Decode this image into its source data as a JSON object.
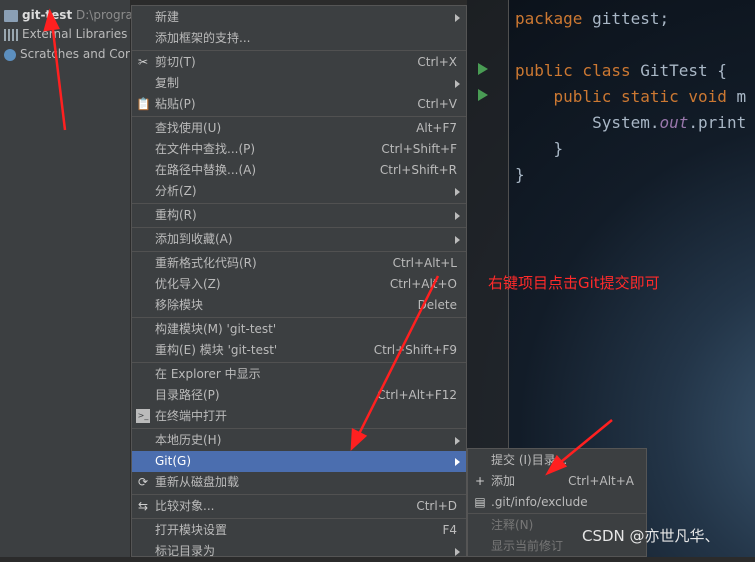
{
  "project_tree": {
    "root_name": "git-test",
    "root_path": "D:\\progra",
    "external_libraries": "External Libraries",
    "scratches": "Scratches and Cor"
  },
  "code_lines": {
    "line1_kw": "package",
    "line1_rest": " gittest;",
    "line2_kw": "public class",
    "line2_rest": " GitTest {",
    "line3_kw": "    public static void",
    "line3_rest": " m",
    "line4_pre": "        System.",
    "line4_field": "out",
    "line4_post": ".print",
    "line5": "    }",
    "line6": "}"
  },
  "context_menu": {
    "items": [
      {
        "label": "新建",
        "shortcut": "",
        "submenu": true,
        "icon": ""
      },
      {
        "label": "添加框架的支持...",
        "shortcut": "",
        "submenu": false,
        "icon": ""
      },
      {
        "label": "剪切(T)",
        "shortcut": "Ctrl+X",
        "submenu": false,
        "icon": "✂"
      },
      {
        "label": "复制",
        "shortcut": "",
        "submenu": true,
        "icon": ""
      },
      {
        "label": "粘贴(P)",
        "shortcut": "Ctrl+V",
        "submenu": false,
        "icon": "📋"
      },
      {
        "label": "查找使用(U)",
        "shortcut": "Alt+F7",
        "submenu": false,
        "icon": ""
      },
      {
        "label": "在文件中查找...(P)",
        "shortcut": "Ctrl+Shift+F",
        "submenu": false,
        "icon": ""
      },
      {
        "label": "在路径中替换...(A)",
        "shortcut": "Ctrl+Shift+R",
        "submenu": false,
        "icon": ""
      },
      {
        "label": "分析(Z)",
        "shortcut": "",
        "submenu": true,
        "icon": ""
      },
      {
        "label": "重构(R)",
        "shortcut": "",
        "submenu": true,
        "icon": ""
      },
      {
        "label": "添加到收藏(A)",
        "shortcut": "",
        "submenu": true,
        "icon": ""
      },
      {
        "label": "重新格式化代码(R)",
        "shortcut": "Ctrl+Alt+L",
        "submenu": false,
        "icon": ""
      },
      {
        "label": "优化导入(Z)",
        "shortcut": "Ctrl+Alt+O",
        "submenu": false,
        "icon": ""
      },
      {
        "label": "移除模块",
        "shortcut": "Delete",
        "submenu": false,
        "icon": ""
      },
      {
        "label": "构建模块(M) 'git-test'",
        "shortcut": "",
        "submenu": false,
        "icon": ""
      },
      {
        "label": "重构(E) 模块 'git-test'",
        "shortcut": "Ctrl+Shift+F9",
        "submenu": false,
        "icon": ""
      },
      {
        "label": "在 Explorer 中显示",
        "shortcut": "",
        "submenu": false,
        "icon": ""
      },
      {
        "label": "目录路径(P)",
        "shortcut": "Ctrl+Alt+F12",
        "submenu": false,
        "icon": ""
      },
      {
        "label": "在终端中打开",
        "shortcut": "",
        "submenu": false,
        "icon": ">_"
      },
      {
        "label": "本地历史(H)",
        "shortcut": "",
        "submenu": true,
        "icon": ""
      },
      {
        "label": "Git(G)",
        "shortcut": "",
        "submenu": true,
        "icon": ""
      },
      {
        "label": "重新从磁盘加载",
        "shortcut": "",
        "submenu": false,
        "icon": "⟳"
      },
      {
        "label": "比较对象...",
        "shortcut": "Ctrl+D",
        "submenu": false,
        "icon": "⇆"
      },
      {
        "label": "打开模块设置",
        "shortcut": "F4",
        "submenu": false,
        "icon": ""
      },
      {
        "label": "标记目录为",
        "shortcut": "",
        "submenu": true,
        "icon": ""
      }
    ]
  },
  "git_submenu": {
    "items": [
      {
        "label": "提交 (I)目录...",
        "shortcut": "",
        "icon": "",
        "disabled": false
      },
      {
        "label": "添加",
        "shortcut": "Ctrl+Alt+A",
        "icon": "+",
        "disabled": false
      },
      {
        "label": ".git/info/exclude",
        "shortcut": "",
        "icon": "▤",
        "disabled": false
      },
      {
        "label": "注释(N)",
        "shortcut": "",
        "icon": "",
        "disabled": true
      },
      {
        "label": "显示当前修订",
        "shortcut": "",
        "icon": "",
        "disabled": true
      }
    ]
  },
  "annotation_text": "右键项目点击Git提交即可",
  "watermark": "CSDN @亦世凡华、",
  "colors": {
    "selection": "#4b6eaf",
    "annotation": "#ff2a2a",
    "menu_bg": "#3c3f41"
  }
}
